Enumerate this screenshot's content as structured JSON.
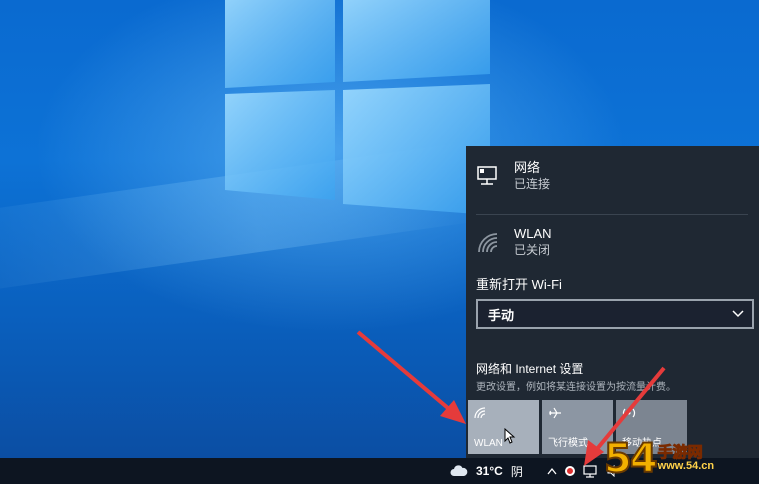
{
  "flyout": {
    "network": {
      "title": "网络",
      "status": "已连接"
    },
    "wlan": {
      "title": "WLAN",
      "status": "已关闭"
    },
    "reconnect_label": "重新打开 Wi-Fi",
    "reconnect_value": "手动",
    "settings_link": "网络和 Internet 设置",
    "settings_desc": "更改设置，例如将某连接设置为按流量计费。",
    "tiles": [
      {
        "label": "WLAN",
        "icon": "wifi-icon",
        "state": "off-hovered"
      },
      {
        "label": "飞行模式",
        "icon": "airplane-icon",
        "state": "off"
      },
      {
        "label": "移动热点",
        "icon": "hotspot-icon",
        "state": "off"
      }
    ]
  },
  "taskbar": {
    "weather_temp": "31°C",
    "weather_cond": "阴",
    "weather_icon": "cloud-icon"
  },
  "watermark": {
    "num": "54",
    "cn": "手游网",
    "url": "www.54.cn"
  },
  "colors": {
    "flyout_bg": "#1f2833",
    "tile_active": "#a7b0bb",
    "arrow": "#e53b3b",
    "taskbar": "#0d1521"
  }
}
